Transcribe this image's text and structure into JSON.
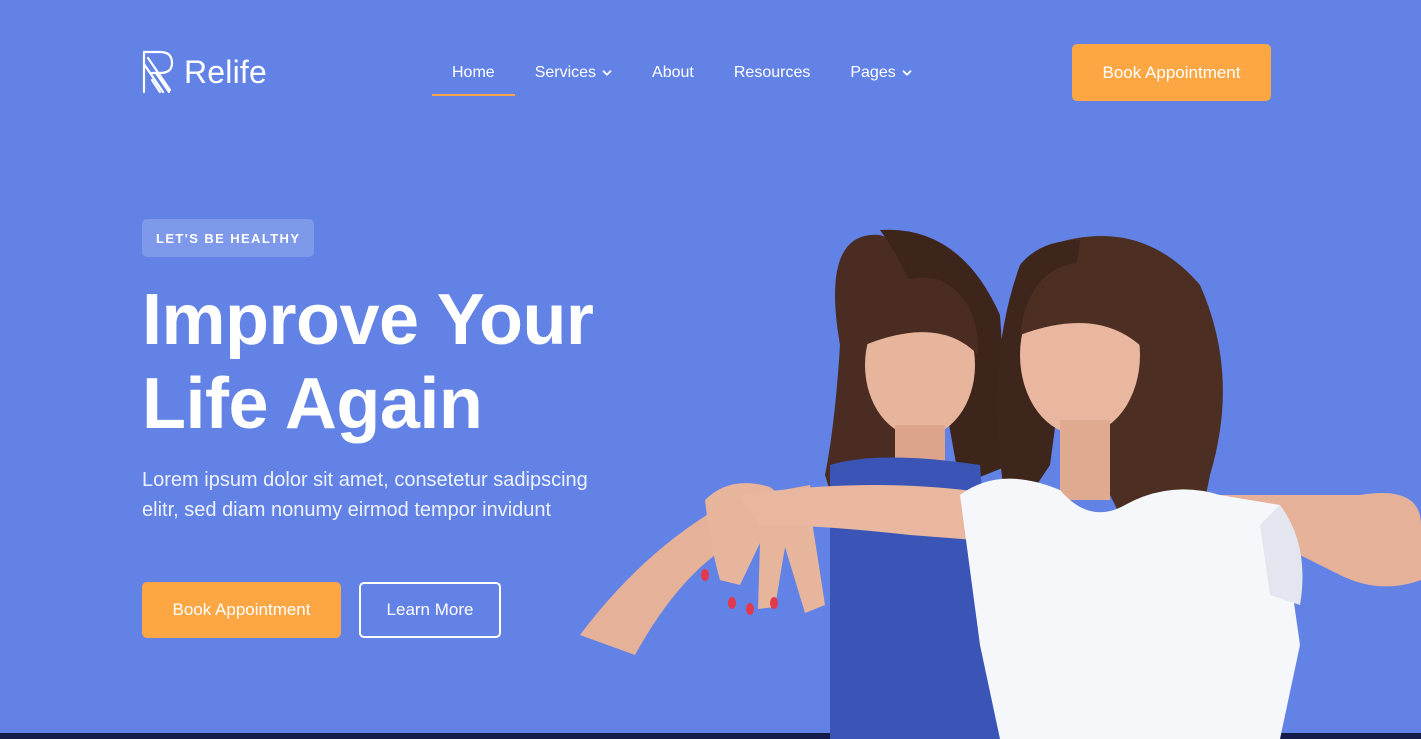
{
  "brand": {
    "name": "Relife"
  },
  "nav": {
    "items": [
      {
        "label": "Home",
        "active": true,
        "dropdown": false
      },
      {
        "label": "Services",
        "active": false,
        "dropdown": true
      },
      {
        "label": "About",
        "active": false,
        "dropdown": false
      },
      {
        "label": "Resources",
        "active": false,
        "dropdown": false
      },
      {
        "label": "Pages",
        "active": false,
        "dropdown": true
      }
    ],
    "cta_label": "Book Appointment"
  },
  "hero": {
    "badge": "LET'S BE HEALTHY",
    "title_line1": "Improve Your",
    "title_line2": "Life Again",
    "description": "Lorem ipsum dolor sit amet, consetetur sadipscing elitr, sed diam nonumy eirmod tempor invidunt",
    "primary_button": "Book Appointment",
    "secondary_button": "Learn More"
  },
  "colors": {
    "background": "#6282e6",
    "accent": "#fda644",
    "footer_strip": "#141a4a"
  },
  "icons": {
    "logo": "relife-logo-icon",
    "dropdown": "chevron-down-icon"
  }
}
